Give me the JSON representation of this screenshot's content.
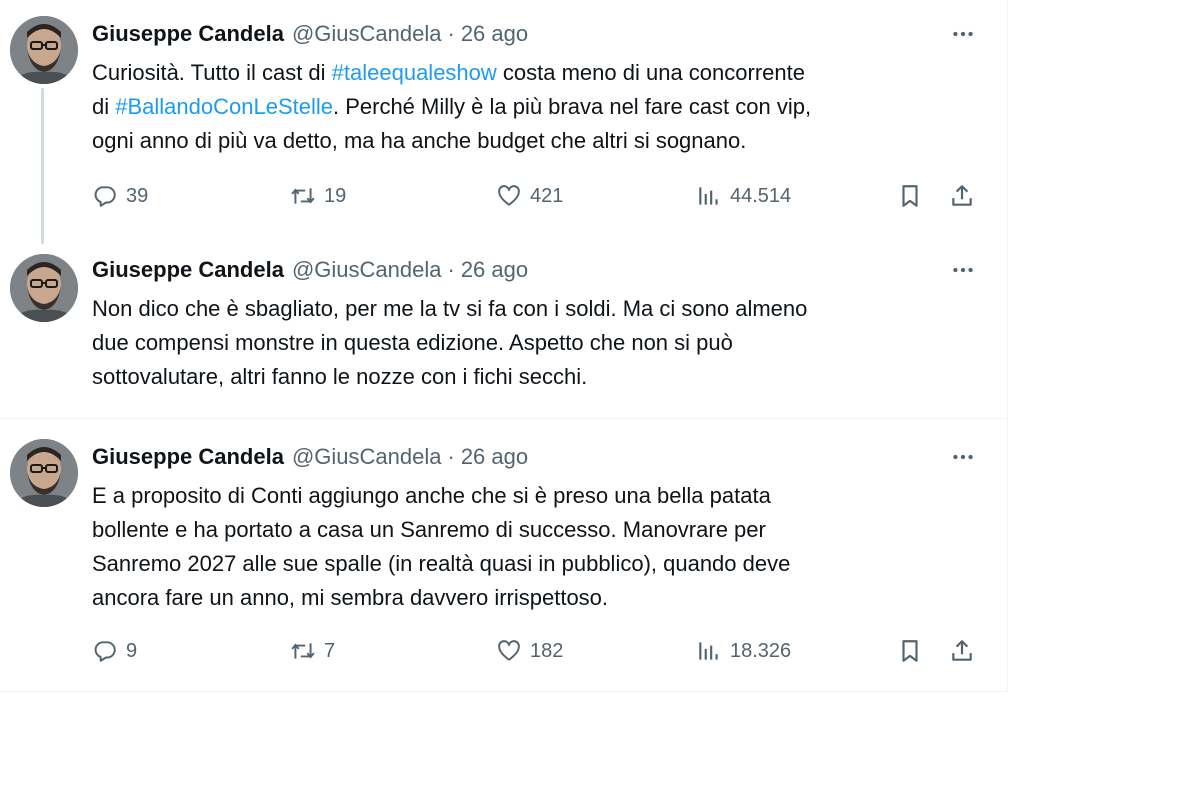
{
  "tweets": [
    {
      "author": {
        "name": "Giuseppe Candela",
        "handle": "@GiusCandela"
      },
      "separator": "·",
      "date": "26 ago",
      "text_lines": [
        [
          {
            "t": "Curiosità. Tutto il cast di "
          },
          {
            "t": "#taleequaleshow",
            "tag": true
          },
          {
            "t": " costa meno di una concorrente"
          }
        ],
        [
          {
            "t": "di "
          },
          {
            "t": "#BallandoConLeStelle",
            "tag": true
          },
          {
            "t": ". Perché Milly è la più brava nel fare cast con vip,"
          }
        ],
        [
          {
            "t": "ogni anno di più va detto, ma ha anche budget che altri si sognano."
          }
        ]
      ],
      "stats": {
        "replies": "39",
        "reposts": "19",
        "likes": "421",
        "views": "44.514"
      }
    },
    {
      "author": {
        "name": "Giuseppe Candela",
        "handle": "@GiusCandela"
      },
      "separator": "·",
      "date": "26 ago",
      "text_lines": [
        [
          {
            "t": "Non dico che è sbagliato, per me la tv si fa con i soldi. Ma ci sono almeno"
          }
        ],
        [
          {
            "t": "due compensi monstre in questa edizione. Aspetto che non si può"
          }
        ],
        [
          {
            "t": "sottovalutare, altri fanno le nozze con i fichi secchi."
          }
        ]
      ]
    },
    {
      "author": {
        "name": "Giuseppe Candela",
        "handle": "@GiusCandela"
      },
      "separator": "·",
      "date": "26 ago",
      "text_lines": [
        [
          {
            "t": "E a proposito di Conti aggiungo anche che si è preso una bella patata"
          }
        ],
        [
          {
            "t": "bollente e ha portato a casa un Sanremo di successo. Manovrare per"
          }
        ],
        [
          {
            "t": "Sanremo 2027 alle sue spalle (in realtà quasi in pubblico), quando deve"
          }
        ],
        [
          {
            "t": "ancora fare un anno, mi sembra davvero irrispettoso."
          }
        ]
      ],
      "stats": {
        "replies": "9",
        "reposts": "7",
        "likes": "182",
        "views": "18.326"
      }
    }
  ],
  "icons": {
    "more": "more-horizontal-icon",
    "reply": "reply-icon",
    "repost": "repost-icon",
    "like": "heart-icon",
    "views": "views-chart-icon",
    "bookmark": "bookmark-icon",
    "share": "share-icon"
  },
  "colors": {
    "text": "#0f1419",
    "secondary": "#536471",
    "link": "#1d9bf0",
    "thread_line": "#cfd9de",
    "divider": "#eff3f4"
  }
}
